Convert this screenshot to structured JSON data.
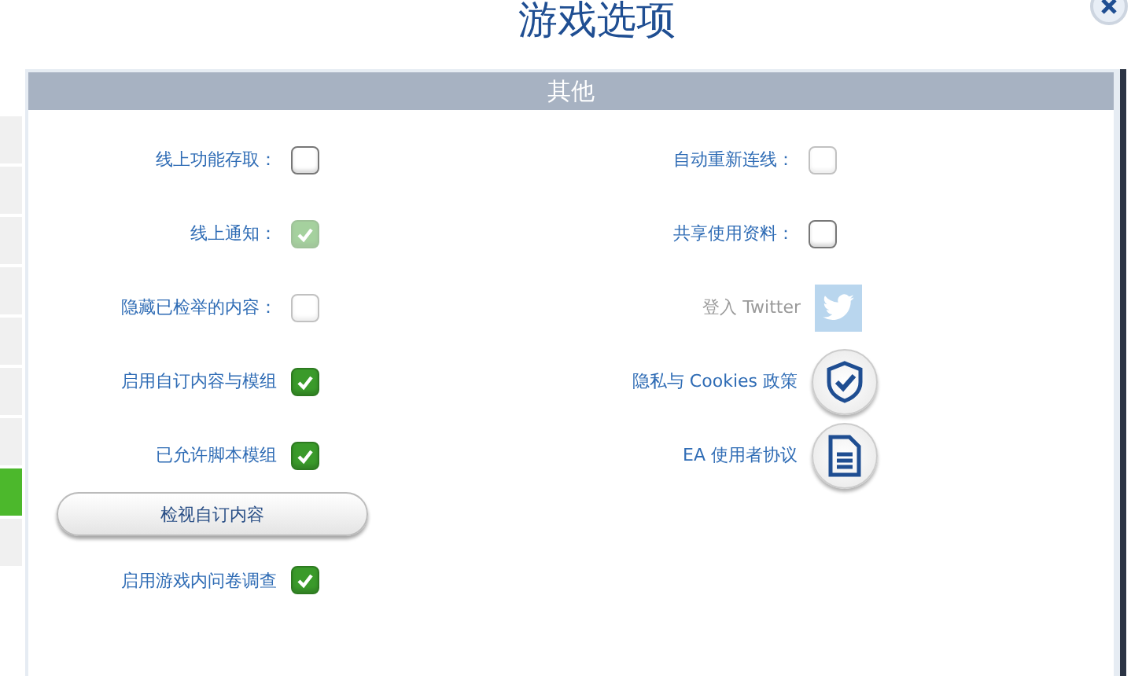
{
  "window": {
    "title": "游戏选项"
  },
  "side_tabs": [
    {
      "selected": false
    },
    {
      "selected": false
    },
    {
      "selected": false
    },
    {
      "selected": false
    },
    {
      "selected": false
    },
    {
      "selected": false
    },
    {
      "selected": false
    },
    {
      "selected": true
    },
    {
      "selected": false
    }
  ],
  "section": {
    "title": "其他"
  },
  "left_options": [
    {
      "kind": "checkbox",
      "label": "线上功能存取：",
      "checked": false,
      "disabled": false
    },
    {
      "kind": "checkbox",
      "label": "线上通知：",
      "checked": true,
      "disabled": true
    },
    {
      "kind": "checkbox",
      "label": "隐藏已检举的内容：",
      "checked": false,
      "disabled": true
    },
    {
      "kind": "checkbox",
      "label": "启用自订内容与模组",
      "checked": true,
      "disabled": false
    },
    {
      "kind": "checkbox",
      "label": "已允许脚本模组",
      "checked": true,
      "disabled": false
    },
    {
      "kind": "button",
      "label": "检视自订内容"
    },
    {
      "kind": "checkbox",
      "label": "启用游戏内问卷调查",
      "checked": true,
      "disabled": false
    }
  ],
  "right_options": [
    {
      "kind": "checkbox",
      "label": "自动重新连线：",
      "checked": false,
      "disabled": true
    },
    {
      "kind": "checkbox",
      "label": "共享使用资料：",
      "checked": false,
      "disabled": false
    },
    {
      "kind": "twitter",
      "label": "登入 Twitter",
      "disabled": true
    },
    {
      "kind": "privacy",
      "label": "隐私与 Cookies 政策"
    },
    {
      "kind": "agreement",
      "label": "EA 使用者协议"
    }
  ]
}
